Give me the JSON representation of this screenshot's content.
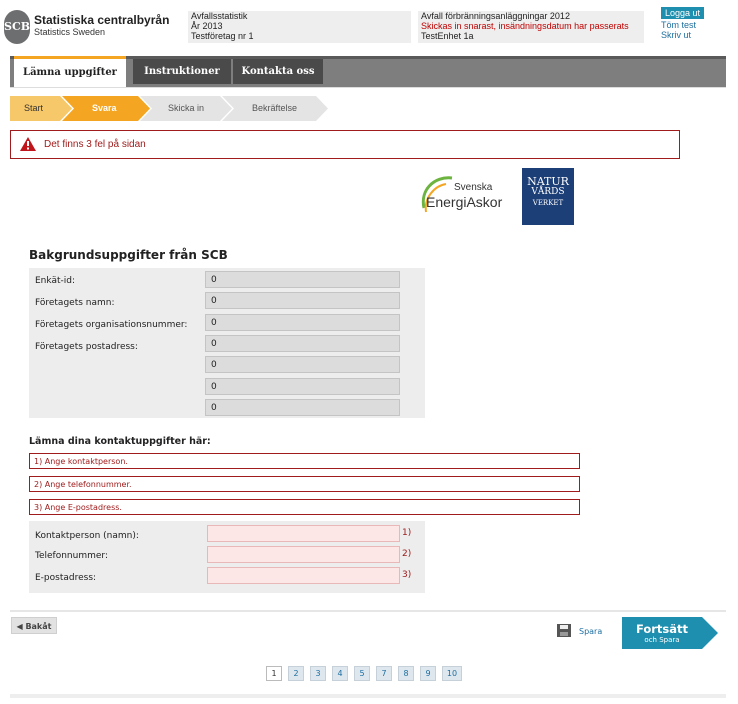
{
  "header": {
    "logo_text": "SCB",
    "brand": "Statistiska centralbyrån",
    "brand_sub": "Statistics Sweden",
    "survey": "Avfallsstatistik",
    "year": "År 2013",
    "company": "Testföretag nr 1",
    "survey_title": "Avfall förbränningsanläggningar 2012",
    "deadline_warning": "Skickas in snarast, insändningsdatum har passerats",
    "unit": "TestEnhet 1a",
    "logout": "Logga ut",
    "clear": "Töm test",
    "print": "Skriv ut"
  },
  "tabs": [
    {
      "label": "Lämna uppgifter",
      "active": true
    },
    {
      "label": "Instruktioner",
      "active": false
    },
    {
      "label": "Kontakta oss",
      "active": false
    }
  ],
  "steps": [
    {
      "label": "Start",
      "state": "done"
    },
    {
      "label": "Svara",
      "state": "current"
    },
    {
      "label": "Skicka in",
      "state": "todo"
    },
    {
      "label": "Bekräftelse",
      "state": "todo"
    }
  ],
  "error_banner": "Det finns 3 fel på sidan",
  "partners": {
    "energi_line1": "Svenska",
    "energi_line2": "EnergiAskor",
    "natur_line1": "NATUR",
    "natur_line2": "VÅRDS",
    "natur_line3": "VERKET"
  },
  "background": {
    "title": "Bakgrundsuppgifter från SCB",
    "labels": {
      "survey_id": "Enkät-id:",
      "company_name": "Företagets namn:",
      "org_number": "Företagets organisationsnummer:",
      "postal_address": "Företagets postadress:"
    },
    "values": {
      "survey_id": "0",
      "company_name": "0",
      "org_number": "0",
      "address_1": "0",
      "address_2": "0",
      "address_3": "0",
      "address_4": "0"
    }
  },
  "contact": {
    "title": "Lämna dina kontaktuppgifter här:",
    "errors": [
      "1) Ange kontaktperson.",
      "2) Ange telefonnummer.",
      "3) Ange E-postadress."
    ],
    "labels": {
      "person": "Kontaktperson (namn):",
      "phone": "Telefonnummer:",
      "email": "E-postadress:"
    },
    "markers": [
      "1)",
      "2)",
      "3)"
    ]
  },
  "footer": {
    "back": "Bakåt",
    "save": "Spara",
    "continue": "Fortsätt",
    "continue_sub": "och Spara",
    "pages": [
      "1",
      "2",
      "3",
      "4",
      "5",
      "7",
      "8",
      "9",
      "10"
    ],
    "current_page": "1"
  },
  "colors": {
    "accent_orange": "#f4a623",
    "error_red": "#a01c1c",
    "continue_teal": "#1e8fae",
    "tab_dark": "#4a4a4a"
  }
}
